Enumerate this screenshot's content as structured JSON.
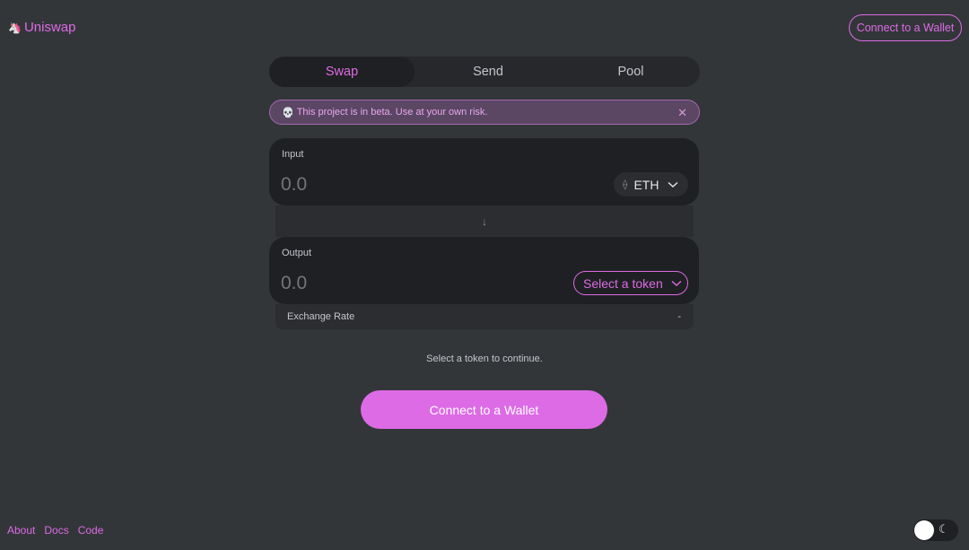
{
  "header": {
    "brand_icon": "unicorn-icon",
    "brand_name": "Uniswap",
    "connect_label": "Connect to a Wallet"
  },
  "tabs": [
    {
      "label": "Swap",
      "active": true
    },
    {
      "label": "Send",
      "active": false
    },
    {
      "label": "Pool",
      "active": false
    }
  ],
  "beta_banner": {
    "text": "This project is in beta. Use at your own risk.",
    "icon": "skull-icon",
    "close_icon": "close-icon"
  },
  "input_panel": {
    "label": "Input",
    "placeholder": "0.0",
    "token": "ETH"
  },
  "output_panel": {
    "label": "Output",
    "placeholder": "0.0",
    "token_placeholder": "Select a token"
  },
  "exchange_rate": {
    "label": "Exchange Rate",
    "value": "-"
  },
  "status_text": "Select a token to continue.",
  "main_button": "Connect to a Wallet",
  "footer": {
    "links": [
      "About",
      "Docs",
      "Code"
    ]
  },
  "theme_toggle": {
    "mode": "dark",
    "icon": "moon-icon"
  },
  "colors": {
    "accent": "#dc6be5",
    "background": "#333639",
    "panel": "#1f2023"
  }
}
